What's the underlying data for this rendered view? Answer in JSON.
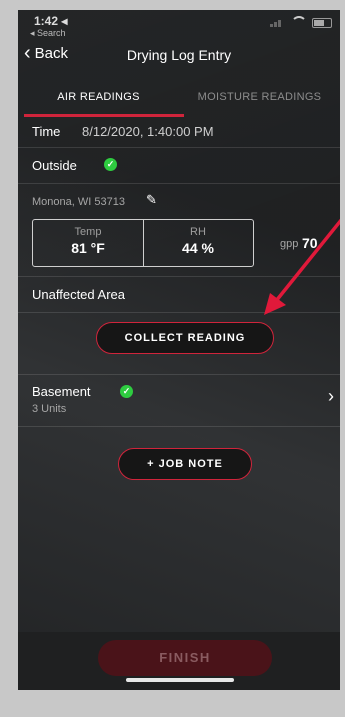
{
  "status": {
    "time": "1:42 ◂",
    "back_to": "◂ Search"
  },
  "nav": {
    "back_label": "Back",
    "title": "Drying Log Entry"
  },
  "tabs": [
    {
      "label": "AIR READINGS",
      "active": true
    },
    {
      "label": "MOISTURE READINGS",
      "active": false
    }
  ],
  "time_row": {
    "label": "Time",
    "value": "8/12/2020, 1:40:00 PM"
  },
  "outside": {
    "label": "Outside",
    "location": "Monona, WI 53713",
    "temp_caption": "Temp",
    "temp_value": "81 °F",
    "rh_caption": "RH",
    "rh_value": "44 %",
    "gpp_caption": "gpp",
    "gpp_value": "70"
  },
  "unaffected": {
    "label": "Unaffected Area",
    "collect_button": "COLLECT READING"
  },
  "basement": {
    "label": "Basement",
    "units": "3 Units"
  },
  "job_note_button": "+ JOB NOTE",
  "finish_button": "FINISH",
  "colors": {
    "accent": "#d0243b",
    "check": "#2ecc40",
    "background": "#2a2c2e"
  },
  "annotation": {
    "arrow_color": "#e0193a"
  }
}
